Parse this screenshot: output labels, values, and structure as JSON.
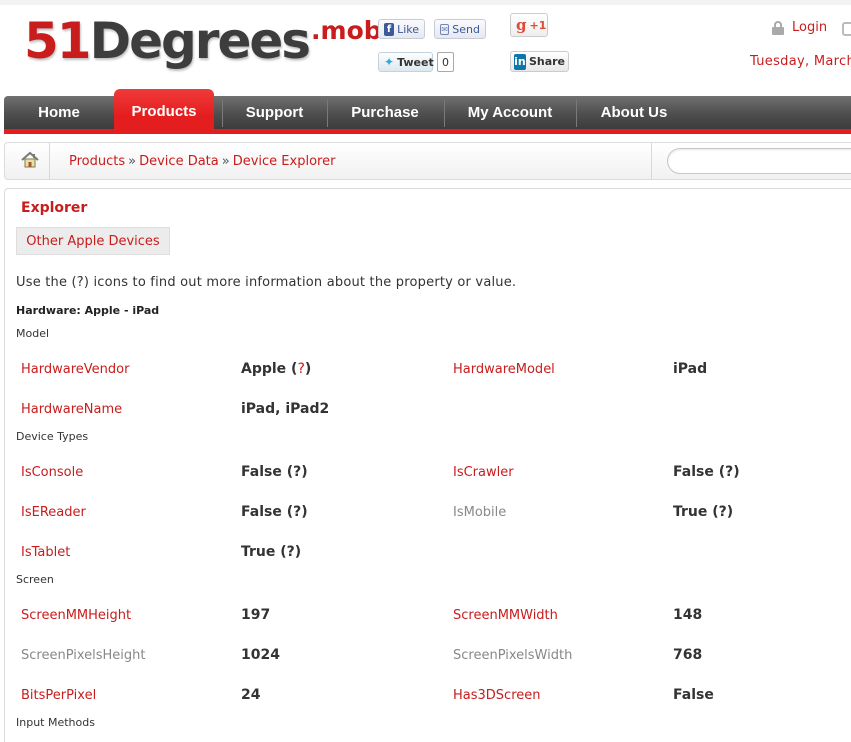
{
  "header": {
    "logo": {
      "part1": "51",
      "part2": "Degrees",
      "part3": ".mobi"
    },
    "social": {
      "like": "Like",
      "send": "Send",
      "tweet": "Tweet",
      "tweet_count": "0",
      "gplus": "+1",
      "share": "Share"
    },
    "login": "Login",
    "date": "Tuesday, March"
  },
  "nav": {
    "items": [
      "Home",
      "Products",
      "Support",
      "Purchase",
      "My Account",
      "About Us"
    ],
    "active": "Products"
  },
  "breadcrumb": {
    "items": [
      "Products",
      "Device Data",
      "Device Explorer"
    ],
    "separator": "»"
  },
  "search": {
    "placeholder": ""
  },
  "content": {
    "title": "Explorer",
    "other_devices": "Other Apple Devices",
    "hint": "Use the (?) icons to find out more information about the property or value.",
    "hardware_title": "Hardware: Apple - iPad",
    "sections": {
      "model": "Model",
      "device_types": "Device Types",
      "screen": "Screen",
      "input_methods": "Input Methods"
    },
    "properties": {
      "hardware_vendor": {
        "label": "HardwareVendor",
        "value": "Apple",
        "help": "?"
      },
      "hardware_model": {
        "label": "HardwareModel",
        "value": "iPad"
      },
      "hardware_name": {
        "label": "HardwareName",
        "value": "iPad, iPad2"
      },
      "is_console": {
        "label": "IsConsole",
        "value": "False (?)"
      },
      "is_crawler": {
        "label": "IsCrawler",
        "value": "False (?)"
      },
      "is_ereader": {
        "label": "IsEReader",
        "value": "False (?)"
      },
      "is_mobile": {
        "label": "IsMobile",
        "value": "True (?)"
      },
      "is_tablet": {
        "label": "IsTablet",
        "value": "True (?)"
      },
      "screen_mm_height": {
        "label": "ScreenMMHeight",
        "value": "197"
      },
      "screen_mm_width": {
        "label": "ScreenMMWidth",
        "value": "148"
      },
      "screen_pixels_height": {
        "label": "ScreenPixelsHeight",
        "value": "1024"
      },
      "screen_pixels_width": {
        "label": "ScreenPixelsWidth",
        "value": "768"
      },
      "bits_per_pixel": {
        "label": "BitsPerPixel",
        "value": "24"
      },
      "has_3d_screen": {
        "label": "Has3DScreen",
        "value": "False"
      }
    }
  },
  "colors": {
    "brand_red": "#c91c1c",
    "nav_red": "#e41e1e",
    "nav_dark": "#4e4e4e"
  }
}
